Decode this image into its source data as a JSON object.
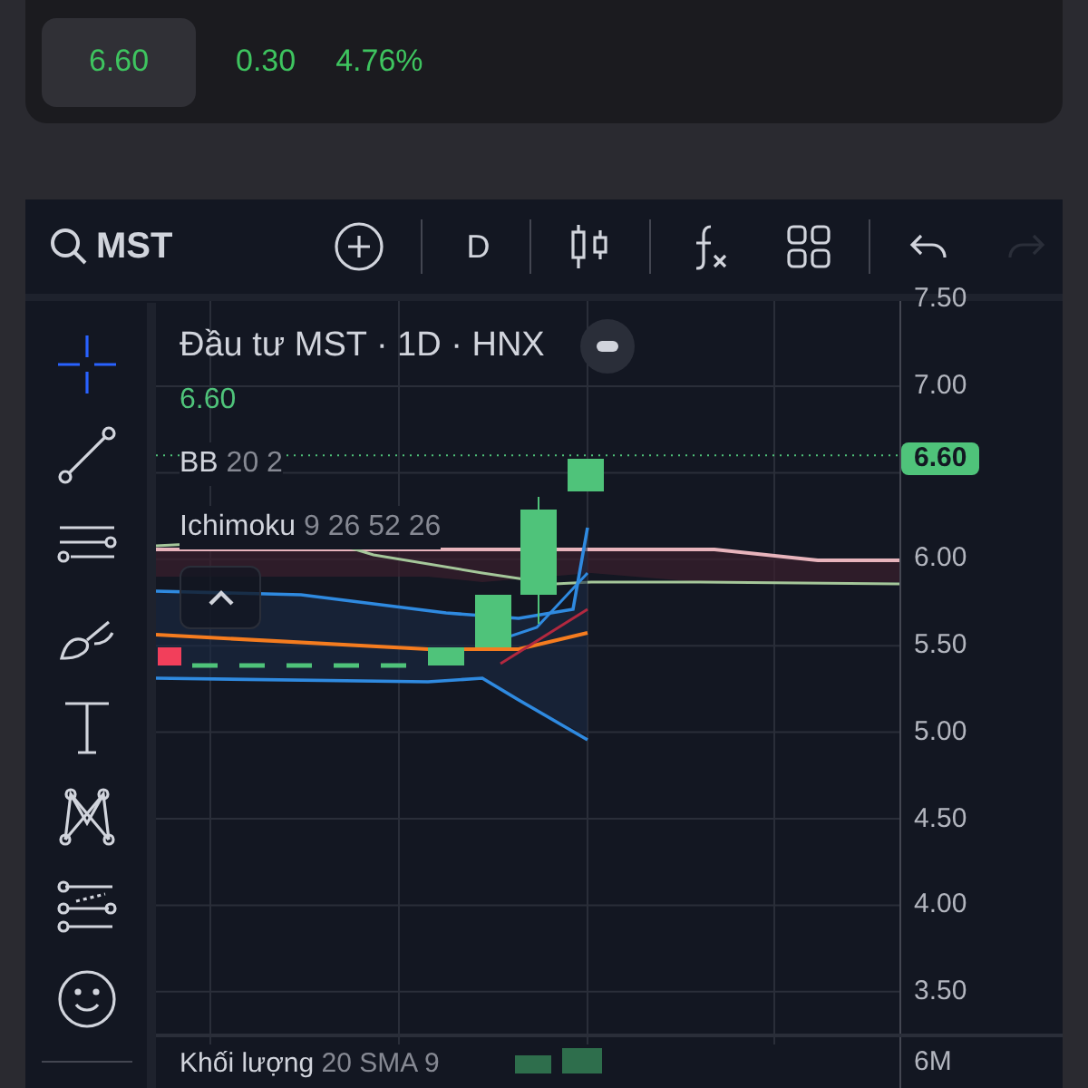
{
  "quote": {
    "price": "6.60",
    "change": "0.30",
    "percent": "4.76%"
  },
  "toolbar": {
    "symbol": "MST",
    "interval": "D",
    "history": [
      {
        "kind": "undo",
        "disabled": false
      },
      {
        "kind": "redo",
        "disabled": true
      }
    ]
  },
  "tools": [
    {
      "kind": "crosshair",
      "selected": true
    },
    {
      "kind": "trend-line",
      "selected": false
    },
    {
      "kind": "lines",
      "selected": false
    },
    {
      "kind": "brush",
      "selected": false
    },
    {
      "kind": "text",
      "selected": false
    },
    {
      "kind": "pattern",
      "selected": false
    },
    {
      "kind": "fib",
      "selected": false
    },
    {
      "kind": "emoji",
      "selected": false
    }
  ],
  "legend": {
    "title": "Đầu tư MST · 1D · HNX",
    "last": "6.60",
    "indicators": [
      {
        "name": "BB",
        "params": "20 2"
      },
      {
        "name": "Ichimoku",
        "params": "9 26 52 26"
      }
    ]
  },
  "price_axis": {
    "labels": [
      "7.50",
      "7.00",
      "6.00",
      "5.50",
      "5.00",
      "4.50",
      "4.00",
      "3.50"
    ],
    "tag": "6.60"
  },
  "volume": {
    "name": "Khối lượng",
    "params": "20 SMA 9",
    "axis_label": "6M"
  }
}
